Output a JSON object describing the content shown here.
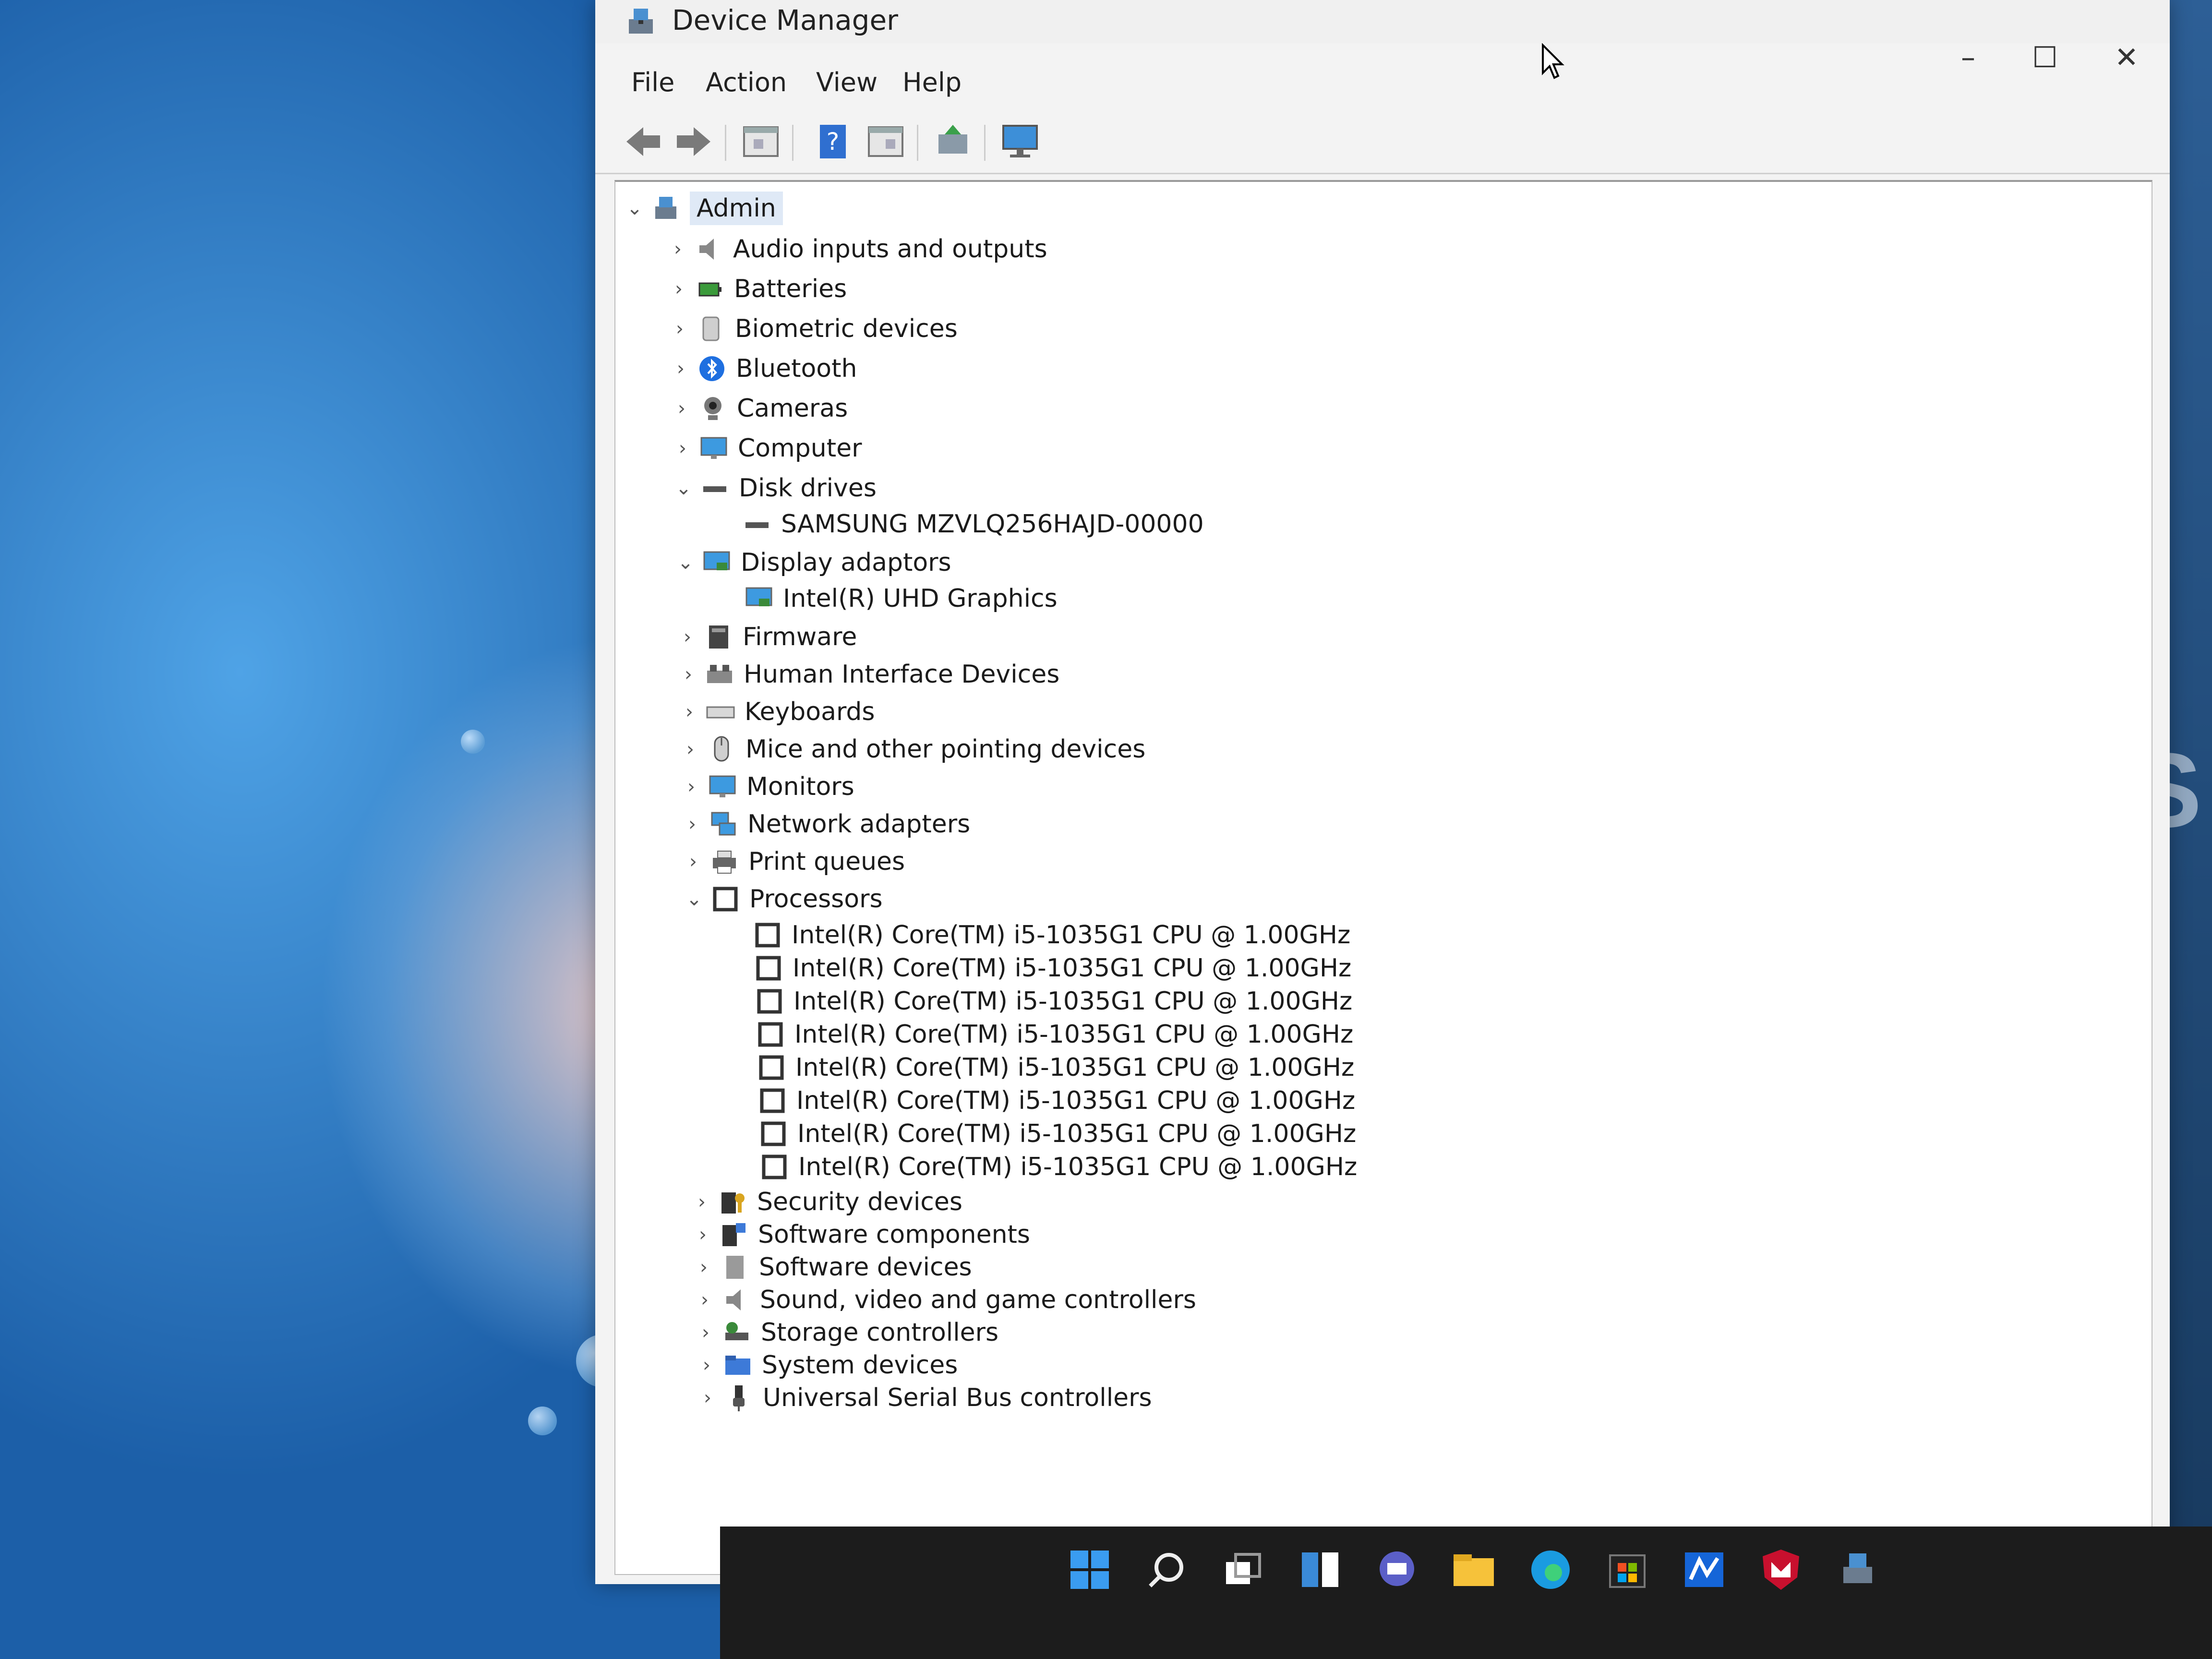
{
  "window": {
    "title": "Device Manager",
    "controls": {
      "minimize": "–",
      "maximize": "☐",
      "close": "✕"
    }
  },
  "menu": [
    "File",
    "Action",
    "View",
    "Help"
  ],
  "toolbar": {
    "buttons": [
      "back-icon",
      "forward-icon",
      "show-hide-console-tree-icon",
      "help-icon",
      "properties-icon",
      "update-driver-icon",
      "scan-hardware-icon"
    ]
  },
  "tree": {
    "root": "Admin",
    "categories": [
      {
        "label": "Audio inputs and outputs",
        "expanded": false,
        "icon": "speaker-icon"
      },
      {
        "label": "Batteries",
        "expanded": false,
        "icon": "battery-icon"
      },
      {
        "label": "Biometric devices",
        "expanded": false,
        "icon": "fingerprint-icon"
      },
      {
        "label": "Bluetooth",
        "expanded": false,
        "icon": "bluetooth-icon"
      },
      {
        "label": "Cameras",
        "expanded": false,
        "icon": "camera-icon"
      },
      {
        "label": "Computer",
        "expanded": false,
        "icon": "monitor-icon"
      },
      {
        "label": "Disk drives",
        "expanded": true,
        "icon": "disk-icon",
        "children": [
          "SAMSUNG MZVLQ256HAJD-00000"
        ]
      },
      {
        "label": "Display adaptors",
        "expanded": true,
        "icon": "display-adapter-icon",
        "children": [
          "Intel(R) UHD Graphics"
        ]
      },
      {
        "label": "Firmware",
        "expanded": false,
        "icon": "firmware-icon"
      },
      {
        "label": "Human Interface Devices",
        "expanded": false,
        "icon": "hid-icon"
      },
      {
        "label": "Keyboards",
        "expanded": false,
        "icon": "keyboard-icon"
      },
      {
        "label": "Mice and other pointing devices",
        "expanded": false,
        "icon": "mouse-icon"
      },
      {
        "label": "Monitors",
        "expanded": false,
        "icon": "monitor-icon"
      },
      {
        "label": "Network adapters",
        "expanded": false,
        "icon": "network-icon"
      },
      {
        "label": "Print queues",
        "expanded": false,
        "icon": "printer-icon"
      },
      {
        "label": "Processors",
        "expanded": true,
        "icon": "processor-icon",
        "children": [
          "Intel(R) Core(TM) i5-1035G1 CPU @ 1.00GHz",
          "Intel(R) Core(TM) i5-1035G1 CPU @ 1.00GHz",
          "Intel(R) Core(TM) i5-1035G1 CPU @ 1.00GHz",
          "Intel(R) Core(TM) i5-1035G1 CPU @ 1.00GHz",
          "Intel(R) Core(TM) i5-1035G1 CPU @ 1.00GHz",
          "Intel(R) Core(TM) i5-1035G1 CPU @ 1.00GHz",
          "Intel(R) Core(TM) i5-1035G1 CPU @ 1.00GHz",
          "Intel(R) Core(TM) i5-1035G1 CPU @ 1.00GHz"
        ]
      },
      {
        "label": "Security devices",
        "expanded": false,
        "icon": "security-icon"
      },
      {
        "label": "Software components",
        "expanded": false,
        "icon": "software-components-icon"
      },
      {
        "label": "Software devices",
        "expanded": false,
        "icon": "software-devices-icon"
      },
      {
        "label": "Sound, video and game controllers",
        "expanded": false,
        "icon": "sound-icon"
      },
      {
        "label": "Storage controllers",
        "expanded": false,
        "icon": "storage-icon"
      },
      {
        "label": "System devices",
        "expanded": false,
        "icon": "folder-icon"
      },
      {
        "label": "Universal Serial Bus controllers",
        "expanded": false,
        "icon": "usb-icon"
      }
    ]
  },
  "taskbar": [
    "start-icon",
    "search-icon",
    "task-view-icon",
    "widgets-icon",
    "chat-icon",
    "file-explorer-icon",
    "edge-icon",
    "store-icon",
    "mail-icon",
    "mcafee-icon",
    "device-manager-icon"
  ],
  "colors": {
    "accent": "#0067c0",
    "tree_bg": "#ffffff",
    "selection": "#dfe9f6"
  }
}
